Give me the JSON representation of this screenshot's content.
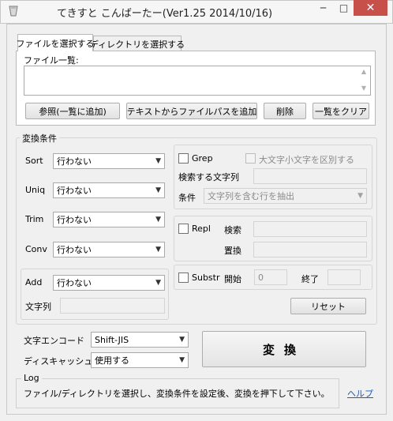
{
  "window": {
    "title": "てきすと こんばーたー(Ver1.25 2014/10/16)",
    "minimize_glyph": "─",
    "maximize_glyph": "□",
    "close_glyph": "✕"
  },
  "tabs": {
    "file_tab": "ファイルを選択する",
    "dir_tab": "ディレクトリを選択する"
  },
  "file_panel": {
    "list_label": "ファイル一覧:",
    "buttons": {
      "browse": "参照(一覧に追加)",
      "add_from_text": "テキストからファイルパスを追加",
      "delete": "削除",
      "clear": "一覧をクリア"
    }
  },
  "conversion": {
    "group_title": "変換条件",
    "sort": {
      "label": "Sort",
      "value": "行わない"
    },
    "uniq": {
      "label": "Uniq",
      "value": "行わない"
    },
    "trim": {
      "label": "Trim",
      "value": "行わない"
    },
    "conv": {
      "label": "Conv",
      "value": "行わない"
    },
    "add": {
      "label": "Add",
      "value": "行わない",
      "string_label": "文字列",
      "string_value": ""
    }
  },
  "grep": {
    "label": "Grep",
    "case_label": "大文字小文字を区別する",
    "search_label": "検索する文字列",
    "search_value": "",
    "condition_label": "条件",
    "condition_value": "文字列を含む行を抽出"
  },
  "repl": {
    "label": "Repl",
    "search_label": "検索",
    "replace_label": "置換",
    "search_value": "",
    "replace_value": ""
  },
  "substr": {
    "label": "Substr",
    "start_label": "開始",
    "start_value": "0",
    "end_label": "終了",
    "end_value": ""
  },
  "reset_button": "リセット",
  "encoding": {
    "label": "文字エンコード",
    "value": "Shift-JIS"
  },
  "disk_cache": {
    "label": "ディスキャッシュ",
    "value": "使用する"
  },
  "convert_button": "変換",
  "log": {
    "title": "Log",
    "message": "ファイル/ディレクトリを選択し、変換条件を設定後、変換を押下して下さい。"
  },
  "help_link": "ヘルプ"
}
